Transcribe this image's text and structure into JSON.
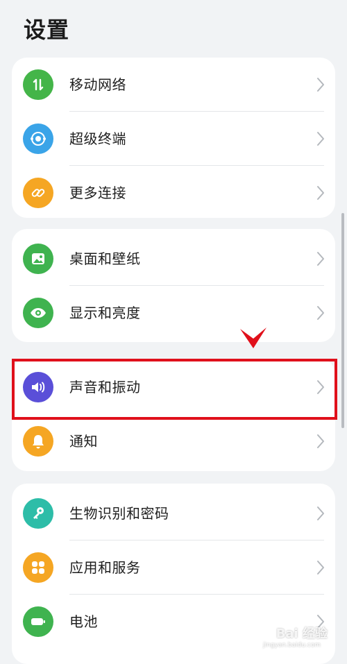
{
  "title": "设置",
  "groups": [
    {
      "items": [
        {
          "label": "移动网络",
          "icon": "mobile-data-icon",
          "color": "#44b549"
        },
        {
          "label": "超级终端",
          "icon": "super-device-icon",
          "color": "#3aa4e8"
        },
        {
          "label": "更多连接",
          "icon": "link-icon",
          "color": "#f5a623"
        }
      ]
    },
    {
      "items": [
        {
          "label": "桌面和壁纸",
          "icon": "wallpaper-icon",
          "color": "#3fb34f"
        },
        {
          "label": "显示和亮度",
          "icon": "eye-icon",
          "color": "#3fb34f"
        }
      ]
    },
    {
      "items": [
        {
          "label": "声音和振动",
          "icon": "sound-icon",
          "color": "#5a4fd8"
        },
        {
          "label": "通知",
          "icon": "bell-icon",
          "color": "#f5a623"
        }
      ]
    },
    {
      "items": [
        {
          "label": "生物识别和密码",
          "icon": "key-icon",
          "color": "#2dbda8"
        },
        {
          "label": "应用和服务",
          "icon": "apps-icon",
          "color": "#f5a623"
        },
        {
          "label": "电池",
          "icon": "battery-icon",
          "color": "#3fb34f"
        }
      ]
    }
  ],
  "annotation": {
    "highlight_color": "#e0101b"
  },
  "watermark": {
    "main": "Bai 经验",
    "sub": "jingyan.baidu.com"
  }
}
